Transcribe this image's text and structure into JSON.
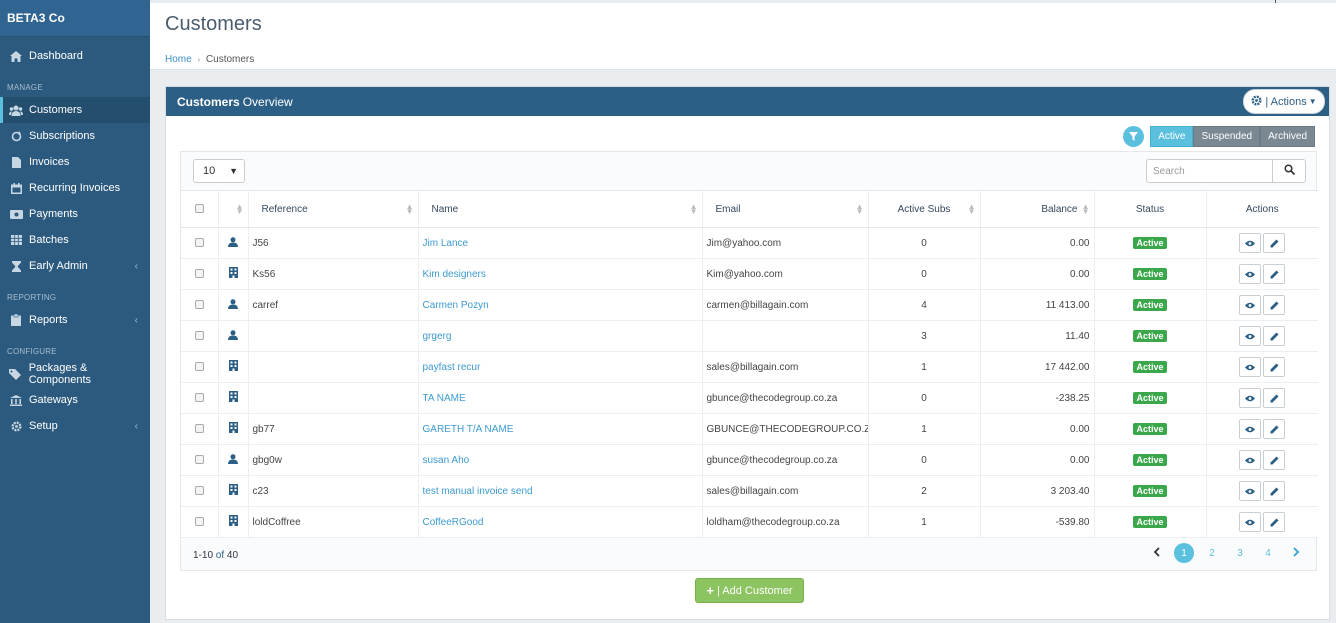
{
  "sidebar": {
    "brand": "BETA3 Co",
    "dashboard": "Dashboard",
    "sections": {
      "manage": "MANAGE",
      "reporting": "REPORTING",
      "configure": "CONFIGURE"
    },
    "items": {
      "customers": "Customers",
      "subscriptions": "Subscriptions",
      "invoices": "Invoices",
      "recurring_invoices": "Recurring Invoices",
      "payments": "Payments",
      "batches": "Batches",
      "early_admin": "Early Admin",
      "reports": "Reports",
      "packages": "Packages & Components",
      "gateways": "Gateways",
      "setup": "Setup"
    },
    "chevron": "‹"
  },
  "header": {
    "title": "Customers",
    "breadcrumb": {
      "home": "Home",
      "separator": "›",
      "current": "Customers"
    }
  },
  "panel": {
    "title_bold": "Customers",
    "title_rest": "Overview",
    "actions_label": "| Actions",
    "filters": {
      "active": "Active",
      "suspended": "Suspended",
      "archived": "Archived"
    }
  },
  "table": {
    "page_size": "10",
    "search_placeholder": "Search",
    "columns": {
      "reference": "Reference",
      "name": "Name",
      "email": "Email",
      "active_subs": "Active Subs",
      "balance": "Balance",
      "status": "Status",
      "actions": "Actions"
    },
    "rows": [
      {
        "type": "person",
        "reference": "J56",
        "name": "Jim Lance",
        "email": "Jim@yahoo.com",
        "active_subs": "0",
        "balance": "0.00",
        "status": "Active"
      },
      {
        "type": "company",
        "reference": "Ks56",
        "name": "Kim designers",
        "email": "Kim@yahoo.com",
        "active_subs": "0",
        "balance": "0.00",
        "status": "Active"
      },
      {
        "type": "person",
        "reference": "carref",
        "name": "Carmen Pozyn",
        "email": "carmen@billagain.com",
        "active_subs": "4",
        "balance": "11 413.00",
        "status": "Active"
      },
      {
        "type": "person",
        "reference": "",
        "name": "grgerg",
        "email": "",
        "active_subs": "3",
        "balance": "11.40",
        "status": "Active"
      },
      {
        "type": "company",
        "reference": "",
        "name": "payfast recur",
        "email": "sales@billagain.com",
        "active_subs": "1",
        "balance": "17 442.00",
        "status": "Active"
      },
      {
        "type": "company",
        "reference": "",
        "name": "TA NAME",
        "email": "gbunce@thecodegroup.co.za",
        "active_subs": "0",
        "balance": "-238.25",
        "status": "Active"
      },
      {
        "type": "company",
        "reference": "gb77",
        "name": "GARETH T/A NAME",
        "email": "GBUNCE@THECODEGROUP.CO.ZA",
        "active_subs": "1",
        "balance": "0.00",
        "status": "Active"
      },
      {
        "type": "person",
        "reference": "gbg0w",
        "name": "susan Aho",
        "email": "gbunce@thecodegroup.co.za",
        "active_subs": "0",
        "balance": "0.00",
        "status": "Active"
      },
      {
        "type": "company",
        "reference": "c23",
        "name": "test manual invoice send",
        "email": "sales@billagain.com",
        "active_subs": "2",
        "balance": "3 203.40",
        "status": "Active"
      },
      {
        "type": "company",
        "reference": "loldCoffree",
        "name": "CoffeeRGood",
        "email": "loldham@thecodegroup.co.za",
        "active_subs": "1",
        "balance": "-539.80",
        "status": "Active"
      }
    ],
    "footer": {
      "range": "1-10",
      "of": "of",
      "total": "40"
    },
    "pages": [
      "1",
      "2",
      "3",
      "4"
    ]
  },
  "add_button": "| Add Customer",
  "colors": {
    "sidebar": "#2c5a7f",
    "panel_head": "#2c5f86",
    "accent": "#5bc0de",
    "status_active": "#3aa84a",
    "add_button": "#8cc461"
  }
}
